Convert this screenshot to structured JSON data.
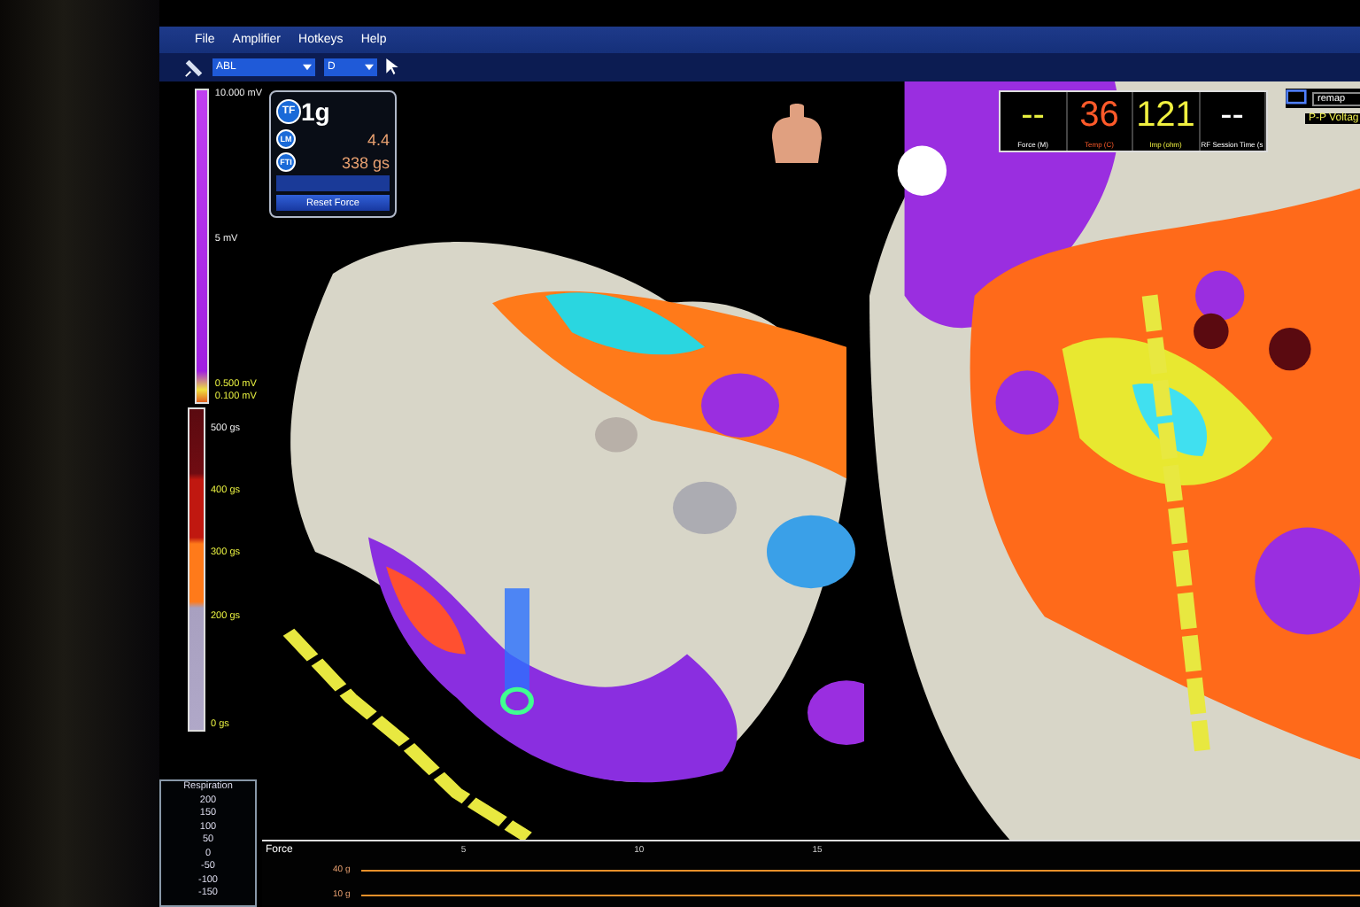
{
  "menu": [
    {
      "label": "File"
    },
    {
      "label": "Amplifier"
    },
    {
      "label": "Hotkeys"
    },
    {
      "label": "Help"
    }
  ],
  "toolbar": {
    "dropdowns": [
      {
        "value": "ABL"
      },
      {
        "value": "D"
      }
    ]
  },
  "voltage_scale": {
    "top": "10.000 mV",
    "middle": "5 mV",
    "upper_threshold": "0.500 mV",
    "lower_threshold": "0.100 mV"
  },
  "force_scale": {
    "labels": [
      "500 gs",
      "400 gs",
      "300 gs",
      "200 gs"
    ],
    "bottom": "0 gs"
  },
  "force_panel": {
    "rows": [
      {
        "badge": "TF",
        "value": "1g"
      },
      {
        "badge": "LM",
        "value": "4.4"
      },
      {
        "badge": "FTI",
        "value": "338 gs"
      }
    ],
    "button": "Reset Force"
  },
  "rf_panel": {
    "metrics": [
      {
        "value": "--",
        "label": "Force (M)",
        "color": "#e8f040"
      },
      {
        "value": "36",
        "label": "Temp (C)",
        "color": "#ff5a2a"
      },
      {
        "value": "121",
        "label": "Imp (ohm)",
        "color": "#f0f040"
      },
      {
        "value": "--",
        "label": "RF Session Time (s",
        "color": "#ffffff"
      }
    ]
  },
  "remap": {
    "label": "remap",
    "caption": "P-P Voltag"
  },
  "respiration": {
    "title": "Respiration",
    "ticks": [
      "200",
      "150",
      "100",
      "50",
      "0",
      "-50",
      "-100",
      "-150"
    ]
  },
  "force_strip": {
    "title": "Force",
    "lane_labels": [
      "40 g",
      "10 g"
    ],
    "ticks": [
      "5",
      "10",
      "15"
    ]
  }
}
